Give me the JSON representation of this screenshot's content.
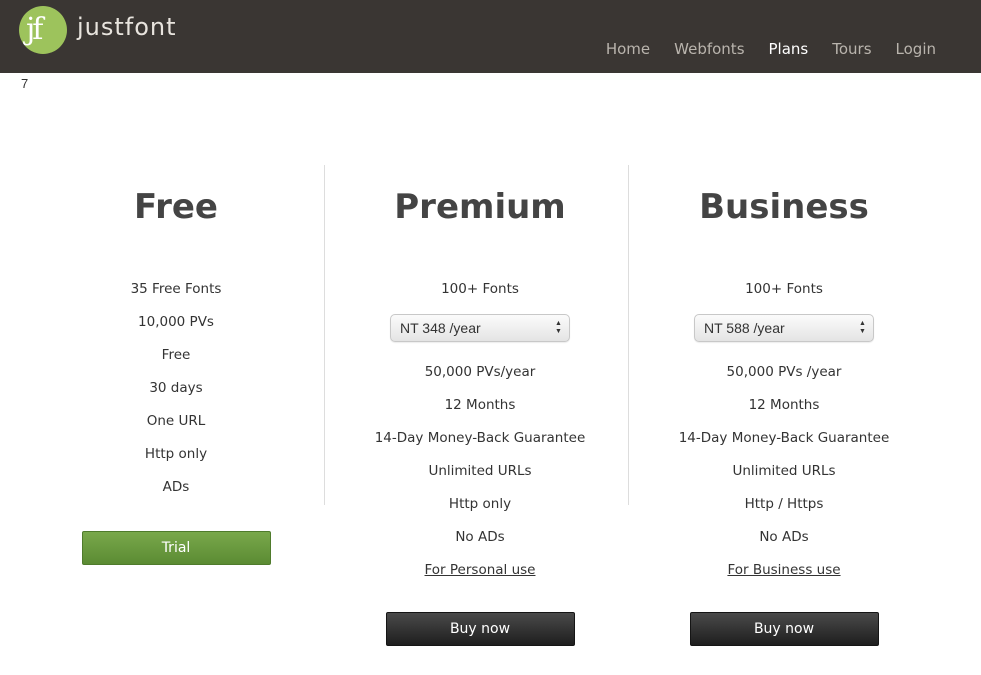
{
  "brand": {
    "logo_glyph": "jf",
    "name": "justfont",
    "logo_color": "#9dc35c"
  },
  "nav": {
    "items": [
      {
        "label": "Home",
        "active": false
      },
      {
        "label": "Webfonts",
        "active": false
      },
      {
        "label": "Plans",
        "active": true
      },
      {
        "label": "Tours",
        "active": false
      },
      {
        "label": "Login",
        "active": false
      }
    ]
  },
  "stray_text": "7",
  "plans": {
    "free": {
      "title": "Free",
      "features": [
        "35 Free Fonts",
        "10,000 PVs",
        "Free",
        "30 days",
        "One URL",
        "Http only",
        "ADs"
      ],
      "button": "Trial"
    },
    "premium": {
      "title": "Premium",
      "fonts": "100+ Fonts",
      "price_select": "NT 348 /year",
      "features": [
        "50,000 PVs/year",
        "12 Months",
        "14-Day Money-Back Guarantee",
        "Unlimited URLs",
        "Http only",
        "No ADs"
      ],
      "usage_link": "For Personal use",
      "button": "Buy now"
    },
    "business": {
      "title": "Business",
      "fonts": "100+ Fonts",
      "price_select": "NT 588 /year",
      "features": [
        "50,000 PVs /year",
        "12 Months",
        "14-Day Money-Back Guarantee",
        "Unlimited URLs",
        "Http / Https",
        "No ADs"
      ],
      "usage_link": "For Business use",
      "button": "Buy now"
    }
  },
  "colors": {
    "header_bg": "#3a3633",
    "trial_green": "#6a9a3e",
    "buy_dark": "#2a2a2a"
  }
}
